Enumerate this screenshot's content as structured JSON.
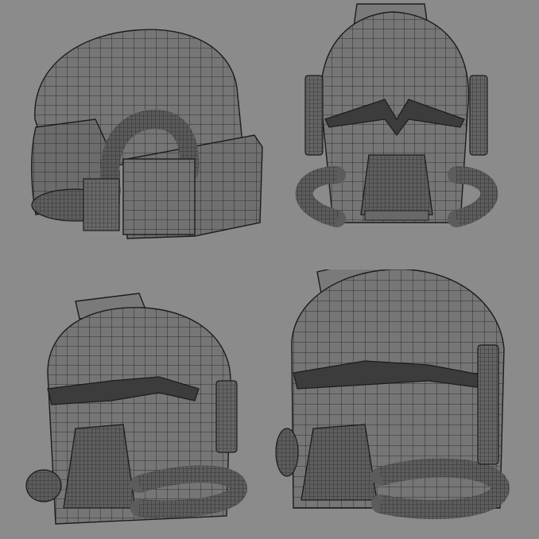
{
  "scene": {
    "background_color": "#8b8b8b",
    "mesh_fill": "#6e6e6e",
    "mesh_fill_light": "#7c7c7c",
    "mesh_fill_dark": "#505050",
    "wire_color": "#1c1c1c",
    "views": [
      {
        "name": "three-quarter-left",
        "subject": "helmet-icon"
      },
      {
        "name": "front",
        "subject": "helmet-icon"
      },
      {
        "name": "three-quarter-front-left",
        "subject": "helmet-icon"
      },
      {
        "name": "three-quarter-front-right",
        "subject": "helmet-icon"
      }
    ]
  }
}
